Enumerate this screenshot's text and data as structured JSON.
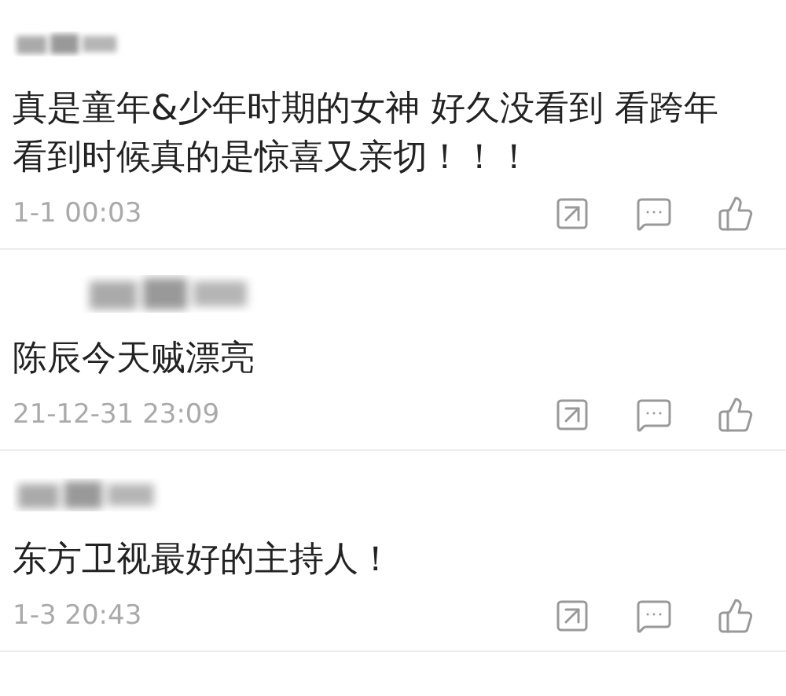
{
  "comments": [
    {
      "text": "真是童年&少年时期的女神 好久没看到 看跨年看到时候真的是惊喜又亲切！！！",
      "time": "1-1 00:03"
    },
    {
      "text": "陈辰今天贼漂亮",
      "time": "21-12-31 23:09"
    },
    {
      "text": "东方卫视最好的主持人！",
      "time": "1-3 20:43"
    }
  ]
}
